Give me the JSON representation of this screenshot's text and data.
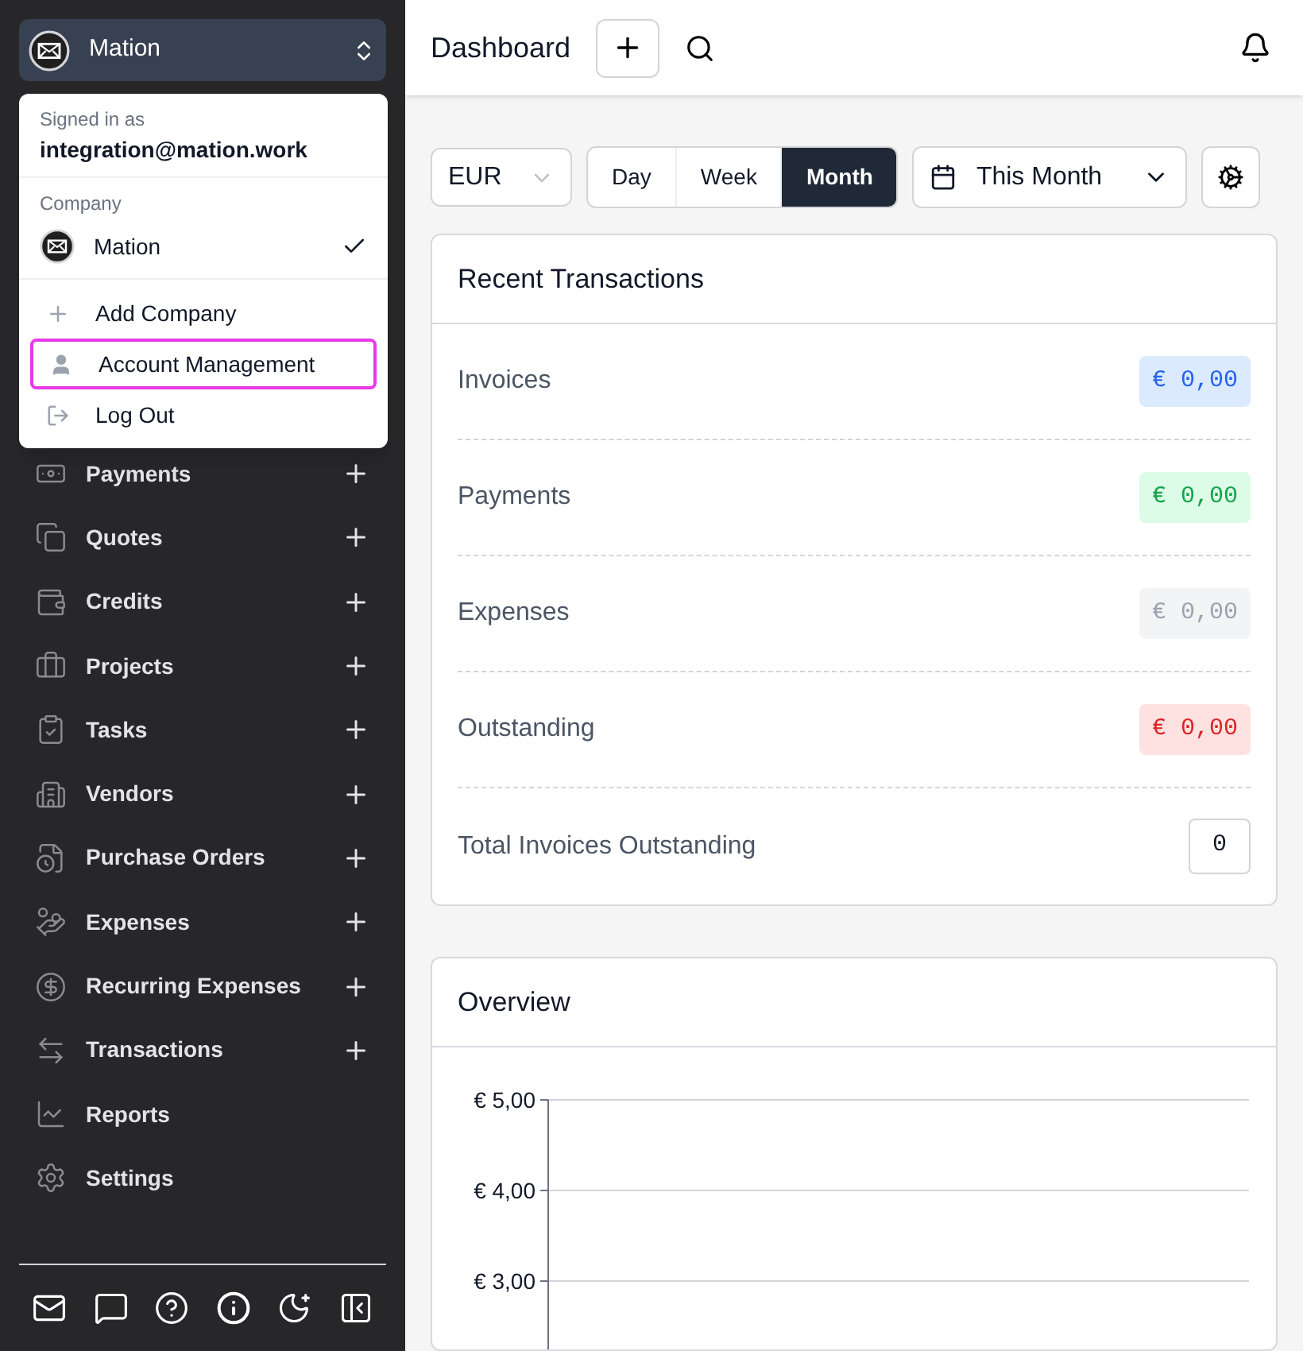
{
  "company_switcher": {
    "name": "Mation"
  },
  "account_menu": {
    "signed_in_label": "Signed in as",
    "email": "integration@mation.work",
    "company_label": "Company",
    "companies": [
      {
        "name": "Mation",
        "selected": true
      }
    ],
    "actions": [
      {
        "kind": "add",
        "label": "Add Company",
        "highlighted": false
      },
      {
        "kind": "account",
        "label": "Account Management",
        "highlighted": true
      },
      {
        "kind": "logout",
        "label": "Log Out",
        "highlighted": false
      }
    ]
  },
  "sidebar": {
    "items": [
      {
        "label": "Payments",
        "addable": true
      },
      {
        "label": "Quotes",
        "addable": true
      },
      {
        "label": "Credits",
        "addable": true
      },
      {
        "label": "Projects",
        "addable": true
      },
      {
        "label": "Tasks",
        "addable": true
      },
      {
        "label": "Vendors",
        "addable": true
      },
      {
        "label": "Purchase Orders",
        "addable": true
      },
      {
        "label": "Expenses",
        "addable": true
      },
      {
        "label": "Recurring Expenses",
        "addable": true
      },
      {
        "label": "Transactions",
        "addable": true
      },
      {
        "label": "Reports",
        "addable": false
      },
      {
        "label": "Settings",
        "addable": false
      }
    ]
  },
  "header": {
    "title": "Dashboard"
  },
  "toolbar": {
    "currency": "EUR",
    "periods": [
      {
        "label": "Day",
        "selected": false
      },
      {
        "label": "Week",
        "selected": false
      },
      {
        "label": "Month",
        "selected": true
      }
    ],
    "date_range": "This Month"
  },
  "recent_transactions": {
    "title": "Recent Transactions",
    "rows": [
      {
        "label": "Invoices",
        "value": "€ 0,00",
        "kind": "blue"
      },
      {
        "label": "Payments",
        "value": "€ 0,00",
        "kind": "green"
      },
      {
        "label": "Expenses",
        "value": "€ 0,00",
        "kind": "gray"
      },
      {
        "label": "Outstanding",
        "value": "€ 0,00",
        "kind": "red"
      },
      {
        "label": "Total Invoices Outstanding",
        "value": "0",
        "kind": "count"
      }
    ]
  },
  "overview": {
    "title": "Overview",
    "y_axis_labels": [
      "€ 5,00",
      "€ 4,00",
      "€ 3,00"
    ]
  }
}
